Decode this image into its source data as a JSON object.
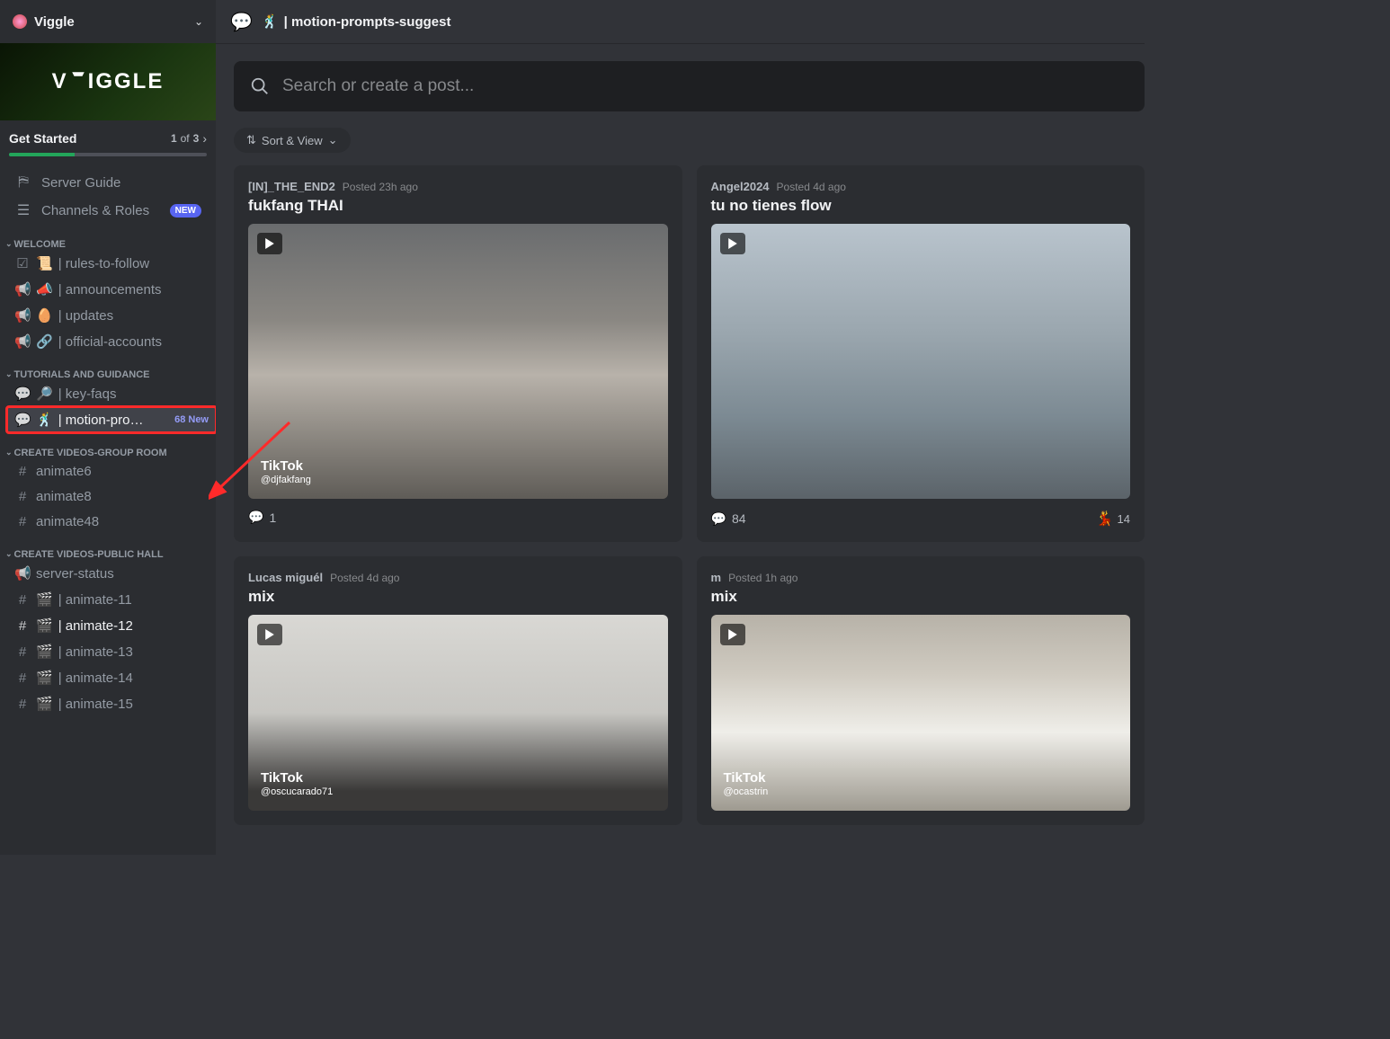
{
  "server": {
    "name": "Viggle",
    "banner_text": "VIGGLE"
  },
  "get_started": {
    "label": "Get Started",
    "progress_current": "1",
    "progress_of": "of",
    "progress_total": "3"
  },
  "nav": {
    "server_guide": "Server Guide",
    "channels_roles": "Channels & Roles",
    "new_badge": "NEW"
  },
  "categories": [
    {
      "label": "WELCOME",
      "channels": [
        {
          "icon_left": "☑",
          "emoji": "📜",
          "name": "| rules-to-follow"
        },
        {
          "icon_left": "📢",
          "emoji": "📣",
          "name": "| announcements"
        },
        {
          "icon_left": "📢",
          "emoji": "🥚",
          "name": "| updates"
        },
        {
          "icon_left": "📢",
          "emoji": "🔗",
          "name": "| official-accounts"
        }
      ]
    },
    {
      "label": "TUTORIALS AND GUIDANCE",
      "channels": [
        {
          "icon_left": "💬",
          "emoji": "🔎",
          "name": "| key-faqs"
        },
        {
          "icon_left": "💬",
          "emoji": "🕺",
          "name": "| motion-pro…",
          "badge": "68 New",
          "active": true
        }
      ]
    },
    {
      "label": "CREATE VIDEOS-GROUP ROOM",
      "channels": [
        {
          "icon_left": "#",
          "emoji": "",
          "name": "animate6"
        },
        {
          "icon_left": "#",
          "emoji": "",
          "name": "animate8"
        },
        {
          "icon_left": "#",
          "emoji": "",
          "name": "animate48"
        }
      ]
    },
    {
      "label": "CREATE VIDEOS-PUBLIC HALL",
      "channels": [
        {
          "icon_left": "📢",
          "emoji": "",
          "name": "server-status"
        },
        {
          "icon_left": "#",
          "emoji": "🎬",
          "name": "| animate-11"
        },
        {
          "icon_left": "#",
          "emoji": "🎬",
          "name": "| animate-12",
          "unread": true
        },
        {
          "icon_left": "#",
          "emoji": "🎬",
          "name": "| animate-13"
        },
        {
          "icon_left": "#",
          "emoji": "🎬",
          "name": "| animate-14"
        },
        {
          "icon_left": "#",
          "emoji": "🎬",
          "name": "| animate-15"
        }
      ]
    }
  ],
  "topbar": {
    "emoji": "🕺",
    "title": "| motion-prompts-suggest"
  },
  "search": {
    "placeholder": "Search or create a post..."
  },
  "sort_button": "Sort & View",
  "posts": [
    {
      "author": "[IN]_THE_END2",
      "time": "Posted 23h ago",
      "title": "fukfang THAI",
      "comments": "1",
      "watermark": "@djfakfang",
      "thumb_css": "linear-gradient(180deg,#6a6c6e 0%, #8a8782 35%, #b8b2aa 55%, #5f5c57 100%)"
    },
    {
      "author": "Angel2024",
      "time": "Posted 4d ago",
      "title": "tu no tienes flow",
      "comments": "84",
      "reaction_emoji": "💃",
      "reaction_count": "14",
      "thumb_css": "linear-gradient(180deg,#b9c4cd 0%, #9aa6ae 40%, #7c8a93 70%, #5b6369 100%)"
    },
    {
      "author": "Lucas miguél",
      "time": "Posted 4d ago",
      "title": "mix",
      "watermark": "@oscucarado71",
      "thumb_css": "linear-gradient(180deg,#d9d8d4 0%, #c7c6c2 50%, #3a3938 90%)"
    },
    {
      "author": "m",
      "time": "Posted 1h ago",
      "title": "mix",
      "watermark": "@ocastrin",
      "thumb_css": "linear-gradient(180deg,#b7b2a8 0%, #cfcac0 30%, #efeee9 60%, #9e9a90 100%)"
    }
  ],
  "tiktok_label": "TikTok"
}
